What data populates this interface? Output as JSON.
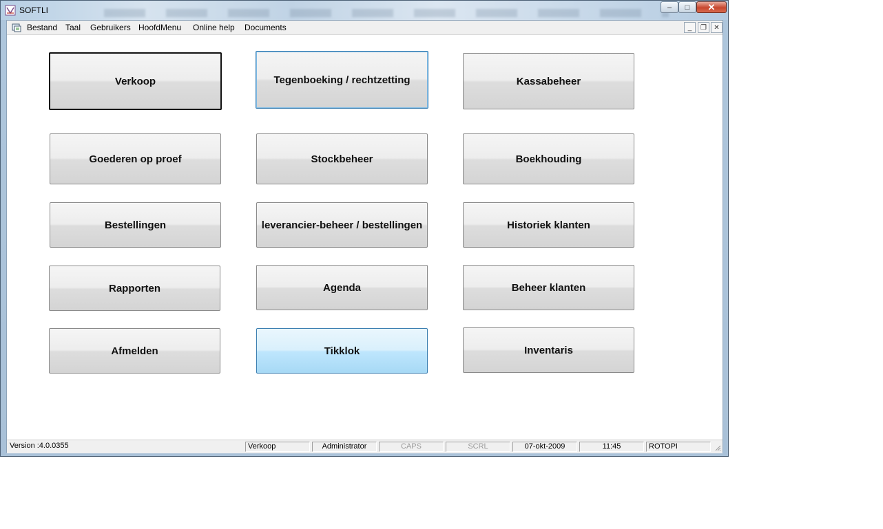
{
  "window": {
    "title": "SOFTLI",
    "controls": {
      "minimize": "–",
      "maximize": "□",
      "close": "✕"
    }
  },
  "menubar": {
    "items": [
      "Bestand",
      "Taal",
      "Gebruikers",
      "HoofdMenu",
      "Online help",
      "Documents"
    ],
    "mdi_controls": {
      "minimize": "_",
      "restore": "❐",
      "close": "✕"
    }
  },
  "buttons": [
    [
      "Verkoop",
      "Tegenboeking / rechtzetting",
      "Kassabeheer"
    ],
    [
      "Goederen op proef",
      "Stockbeheer",
      "Boekhouding"
    ],
    [
      "Bestellingen",
      "leverancier-beheer / bestellingen",
      "Historiek klanten"
    ],
    [
      "Rapporten",
      "Agenda",
      "Beheer klanten"
    ],
    [
      "Afmelden",
      "Tikklok",
      "Inventaris"
    ]
  ],
  "statusbar": {
    "version": "Version :4.0.0355",
    "module": "Verkoop",
    "user": "Administrator",
    "caps": "CAPS",
    "scrl": "SCRL",
    "date": "07-okt-2009",
    "time": "11:45",
    "machine": "ROTOPI"
  },
  "colors": {
    "hover_border": "#3c7fb1",
    "active_fill": "#bee6fd"
  }
}
